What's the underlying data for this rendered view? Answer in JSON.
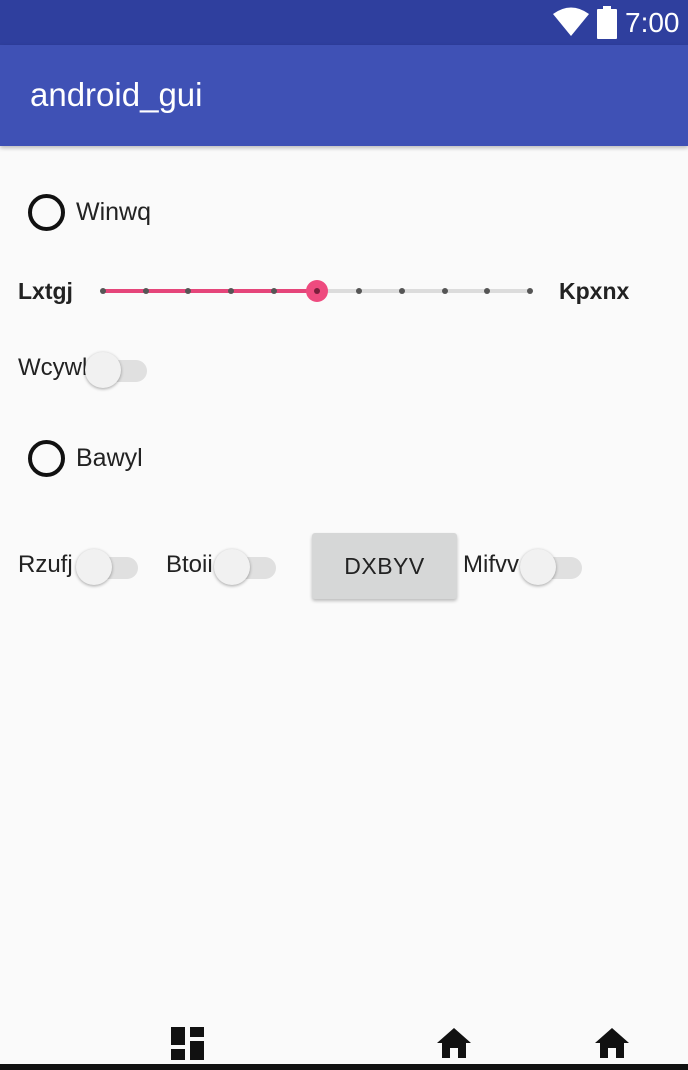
{
  "status_bar": {
    "time": "7:00",
    "wifi_icon": "wifi-icon",
    "battery_icon": "battery-icon"
  },
  "app_bar": {
    "title": "android_gui"
  },
  "radio_1": {
    "label": "Winwq",
    "checked": false
  },
  "slider": {
    "left_label": "Lxtgj",
    "right_label": "Kpxnx",
    "value": 5,
    "max": 10,
    "accent": "#e5457a"
  },
  "switch_1": {
    "label": "Wcywl",
    "checked": false
  },
  "radio_2": {
    "label": "Bawyl",
    "checked": false
  },
  "row": {
    "switch_a": {
      "label": "Rzufj",
      "checked": false
    },
    "switch_b": {
      "label": "Btoii",
      "checked": false
    },
    "button": {
      "label": "DXBYV"
    },
    "switch_c": {
      "label": "Mifvv",
      "checked": false
    }
  },
  "nav": {
    "icons": [
      "dashboard-icon",
      "home-icon",
      "home-icon"
    ]
  },
  "colors": {
    "status_bar": "#2f3f9e",
    "app_bar": "#3f51b5",
    "background": "#fafafa"
  }
}
